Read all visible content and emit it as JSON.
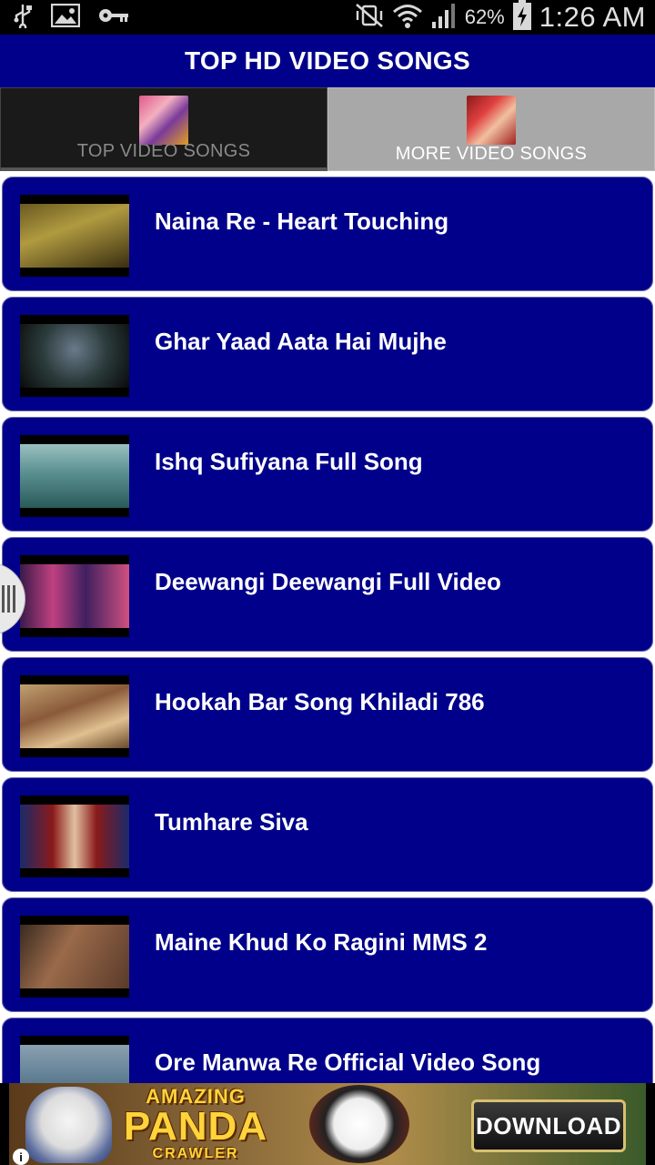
{
  "status_bar": {
    "time": "1:26 AM",
    "battery_percent": "62%",
    "left_icons": [
      "usb-icon",
      "image-icon",
      "key-icon"
    ],
    "right_icons": [
      "mute-vibrate-icon",
      "wifi-icon",
      "signal-icon",
      "battery-charging-icon"
    ]
  },
  "header": {
    "title": "TOP HD VIDEO SONGS"
  },
  "tabs": [
    {
      "label": "TOP VIDEO SONGS",
      "selected": true
    },
    {
      "label": "MORE VIDEO SONGS",
      "selected": false
    }
  ],
  "songs": [
    {
      "title": "Naina Re - Heart Touching"
    },
    {
      "title": "Ghar Yaad Aata Hai Mujhe"
    },
    {
      "title": "Ishq Sufiyana Full Song"
    },
    {
      "title": "Deewangi Deewangi Full Video"
    },
    {
      "title": "Hookah Bar Song Khiladi 786"
    },
    {
      "title": "Tumhare Siva"
    },
    {
      "title": "Maine Khud Ko Ragini MMS 2"
    },
    {
      "title": "Ore Manwa Re Official Video Song"
    }
  ],
  "ad": {
    "line1": "AMAZING",
    "line2": "PANDA",
    "line3": "CRAWLER",
    "button": "DOWNLOAD",
    "info": "i"
  },
  "colors": {
    "header_bg": "#00008a",
    "item_bg": "#00008a",
    "item_text": "#ffffff",
    "tab_selected_bg": "#1a1a1a",
    "tab_unselected_bg": "#a8a8a8"
  }
}
